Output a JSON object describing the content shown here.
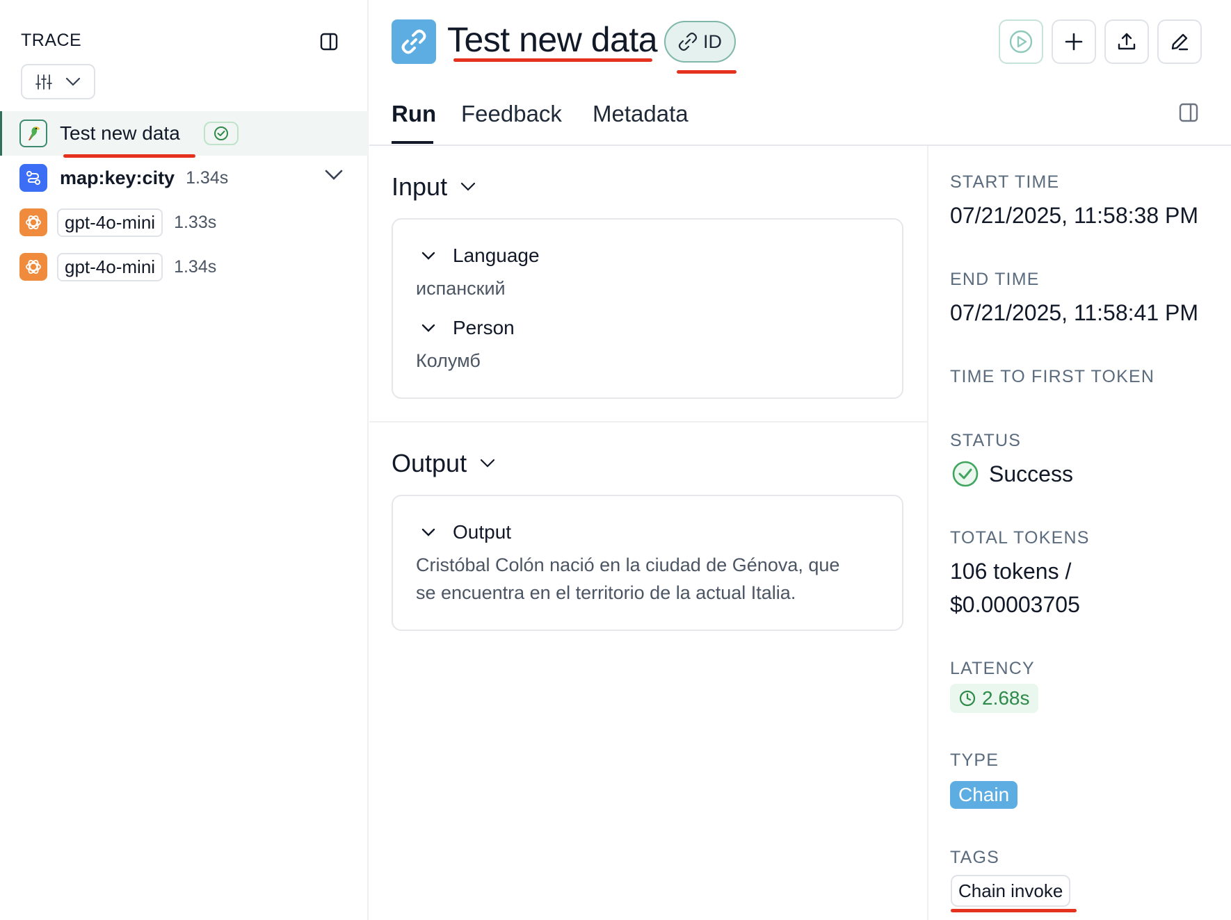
{
  "sidebar": {
    "header": "TRACE",
    "nodes": [
      {
        "name": "Test new data",
        "duration": "",
        "icon": "parrot-icon",
        "active": true
      },
      {
        "name": "map:key:city",
        "duration": "1.34s",
        "icon": "map-route-icon"
      },
      {
        "name": "gpt-4o-mini",
        "duration": "1.33s",
        "icon": "openai-icon"
      },
      {
        "name": "gpt-4o-mini",
        "duration": "1.34s",
        "icon": "openai-icon"
      }
    ]
  },
  "header": {
    "title": "Test new data",
    "id_label": "ID",
    "actions": [
      "play-icon",
      "plus-icon",
      "upload-icon",
      "edit-icon"
    ]
  },
  "tabs": [
    {
      "label": "Run",
      "active": true
    },
    {
      "label": "Feedback"
    },
    {
      "label": "Metadata"
    }
  ],
  "input": {
    "title": "Input",
    "fields": [
      {
        "key": "Language",
        "value": "испанский"
      },
      {
        "key": "Person",
        "value": "Колумб"
      }
    ]
  },
  "output": {
    "title": "Output",
    "field_key": "Output",
    "line1": "Cristóbal Colón nació en la ciudad de Génova, que",
    "line2": "se encuentra en el territorio de la actual Italia."
  },
  "details": {
    "start_label": "START TIME",
    "start_value": "07/21/2025, 11:58:38 PM",
    "end_label": "END TIME",
    "end_value": "07/21/2025, 11:58:41 PM",
    "ttft_label": "TIME TO FIRST TOKEN",
    "status_label": "STATUS",
    "status_value": "Success",
    "tokens_label": "TOTAL TOKENS",
    "tokens_line1": "106 tokens /",
    "tokens_line2": "$0.00003705",
    "latency_label": "LATENCY",
    "latency_value": "2.68s",
    "type_label": "TYPE",
    "type_value": "Chain",
    "tags_label": "TAGS",
    "tags": [
      "Chain invoke"
    ]
  },
  "colors": {
    "accent_blue": "#5dade2",
    "success_green": "#2f8a4a",
    "annotation_red": "#e5321f",
    "openai_orange": "#f08a3c"
  }
}
